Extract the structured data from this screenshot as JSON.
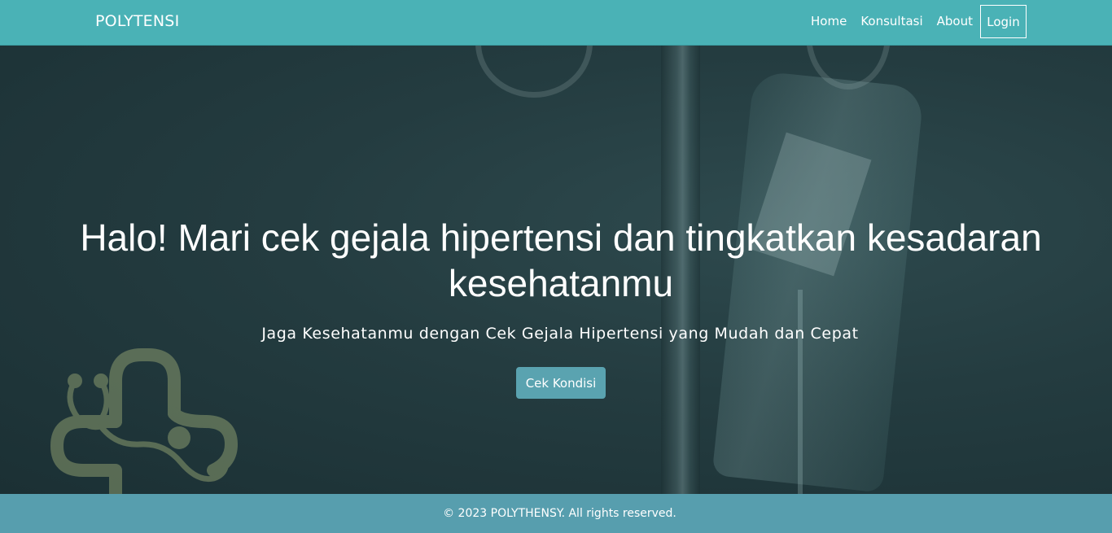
{
  "nav": {
    "brand": "POLYTENSI",
    "links": [
      "Home",
      "Konsultasi",
      "About"
    ],
    "login": "Login"
  },
  "hero": {
    "title": "Halo! Mari cek gejala hipertensi dan tingkatkan kesadaran kesehatanmu",
    "subtitle": "Jaga Kesehatanmu dengan Cek Gejala Hipertensi yang Mudah dan Cepat",
    "cta": "Cek Kondisi"
  },
  "footer": {
    "text": "© 2023 POLYTHENSY. All rights reserved."
  },
  "colors": {
    "navbar": "#4ab2b6",
    "footer": "#579eae",
    "cta": "#5aa3b0",
    "hero_bg": "#243c40",
    "logo": "#8a9a6e"
  },
  "icons": {
    "logo": "medical-cross-stethoscope-icon"
  }
}
